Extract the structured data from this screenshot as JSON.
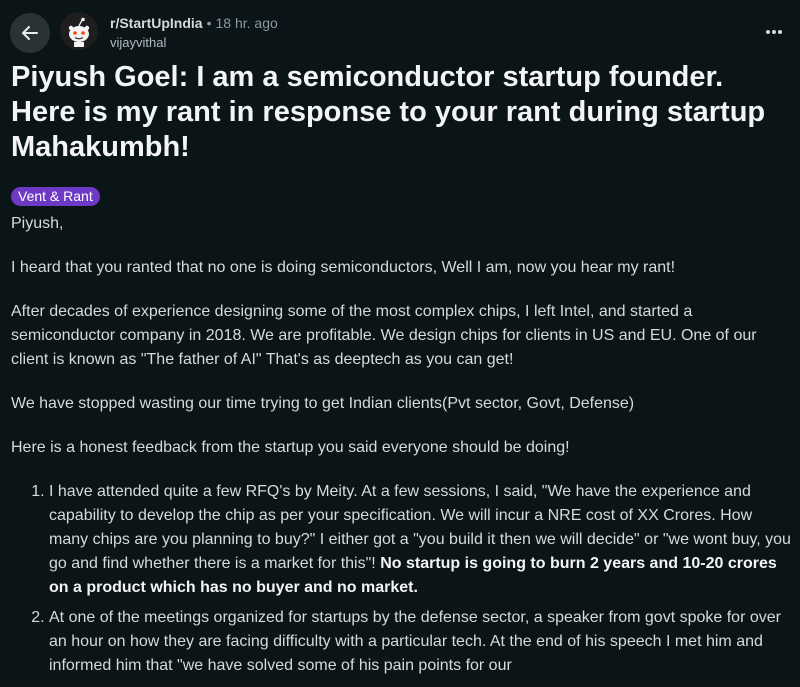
{
  "header": {
    "back_icon": "arrow-left-icon",
    "subreddit": "r/StartUpIndia",
    "separator": "•",
    "time": "18 hr. ago",
    "author": "vijayvithal",
    "more_icon": "ellipsis-icon"
  },
  "post": {
    "title": "Piyush Goel: I am a semiconductor startup founder. Here is my rant in response to your rant during startup Mahakumbh!",
    "flair": "Vent & Rant",
    "paragraphs": [
      "Piyush,",
      "I heard that you ranted that no one is doing semiconductors, Well I am, now you hear my rant!",
      "After decades of experience designing some of the most complex chips, I left Intel, and started a semiconductor company in 2018. We are profitable. We design chips for clients in US and EU. One of our client is known as \"The father of AI\" That's as deeptech as you can get!",
      "We have stopped wasting our time trying to get Indian clients(Pvt sector, Govt, Defense)",
      "Here is a honest feedback from the startup you said everyone should be doing!"
    ],
    "list": [
      {
        "text": "I have attended quite a few RFQ's by Meity. At a few sessions, I said, \"We have the experience and capability to develop the chip as per your specification. We will incur a NRE cost of XX Crores. How many chips are you planning to buy?\" I either got a \"you build it then we will decide\" or \"we wont buy, you go and find whether there is a market for this\"! ",
        "bold": "No startup is going to burn 2 years and 10-20 crores on a product which has no buyer and no market."
      },
      {
        "text": "At one of the meetings organized for startups by the defense sector, a speaker from govt spoke for over an hour on how they are facing difficulty with a particular tech. At the end of his speech I met him and informed him that \"we have solved some of his pain points for our",
        "bold": ""
      }
    ]
  },
  "colors": {
    "background": "#0b1416",
    "text": "#d7dadc",
    "flair_bg": "#6e39c5",
    "button_bg": "#2a3236"
  }
}
